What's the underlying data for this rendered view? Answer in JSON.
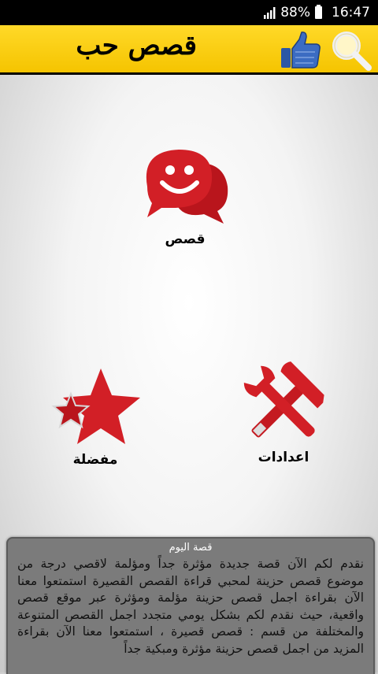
{
  "status_bar": {
    "battery": "88%",
    "time": "16:47"
  },
  "header": {
    "title": "قصص حب",
    "like_icon": "thumbs-up-icon",
    "search_icon": "search-icon"
  },
  "menu": {
    "stories_label": "قصص",
    "favorites_label": "مفضلة",
    "settings_label": "اعدادات"
  },
  "story_of_day": {
    "title": "قصة اليوم",
    "body": "نقدم لكم الآن قصة جديدة مؤثرة جداً ومؤلمة لاقصي درجة من موضوع قصص حزينة لمحبي قراءة القصص القصيرة استمتعوا معنا الآن بقراءة اجمل قصص حزينة مؤلمة ومؤثرة عبر موقع قصص واقعية، حيث نقدم لكم بشكل يومي متجدد اجمل القصص المتنوعة والمختلفة من قسم : قصص قصيرة ، استمتعوا معنا الآن بقراءة المزيد من اجمل قصص حزينة مؤثرة ومبكية جداً"
  },
  "colors": {
    "accent_red": "#d21f26",
    "header_yellow": "#f5c400",
    "story_bg": "#7b7b7b"
  }
}
